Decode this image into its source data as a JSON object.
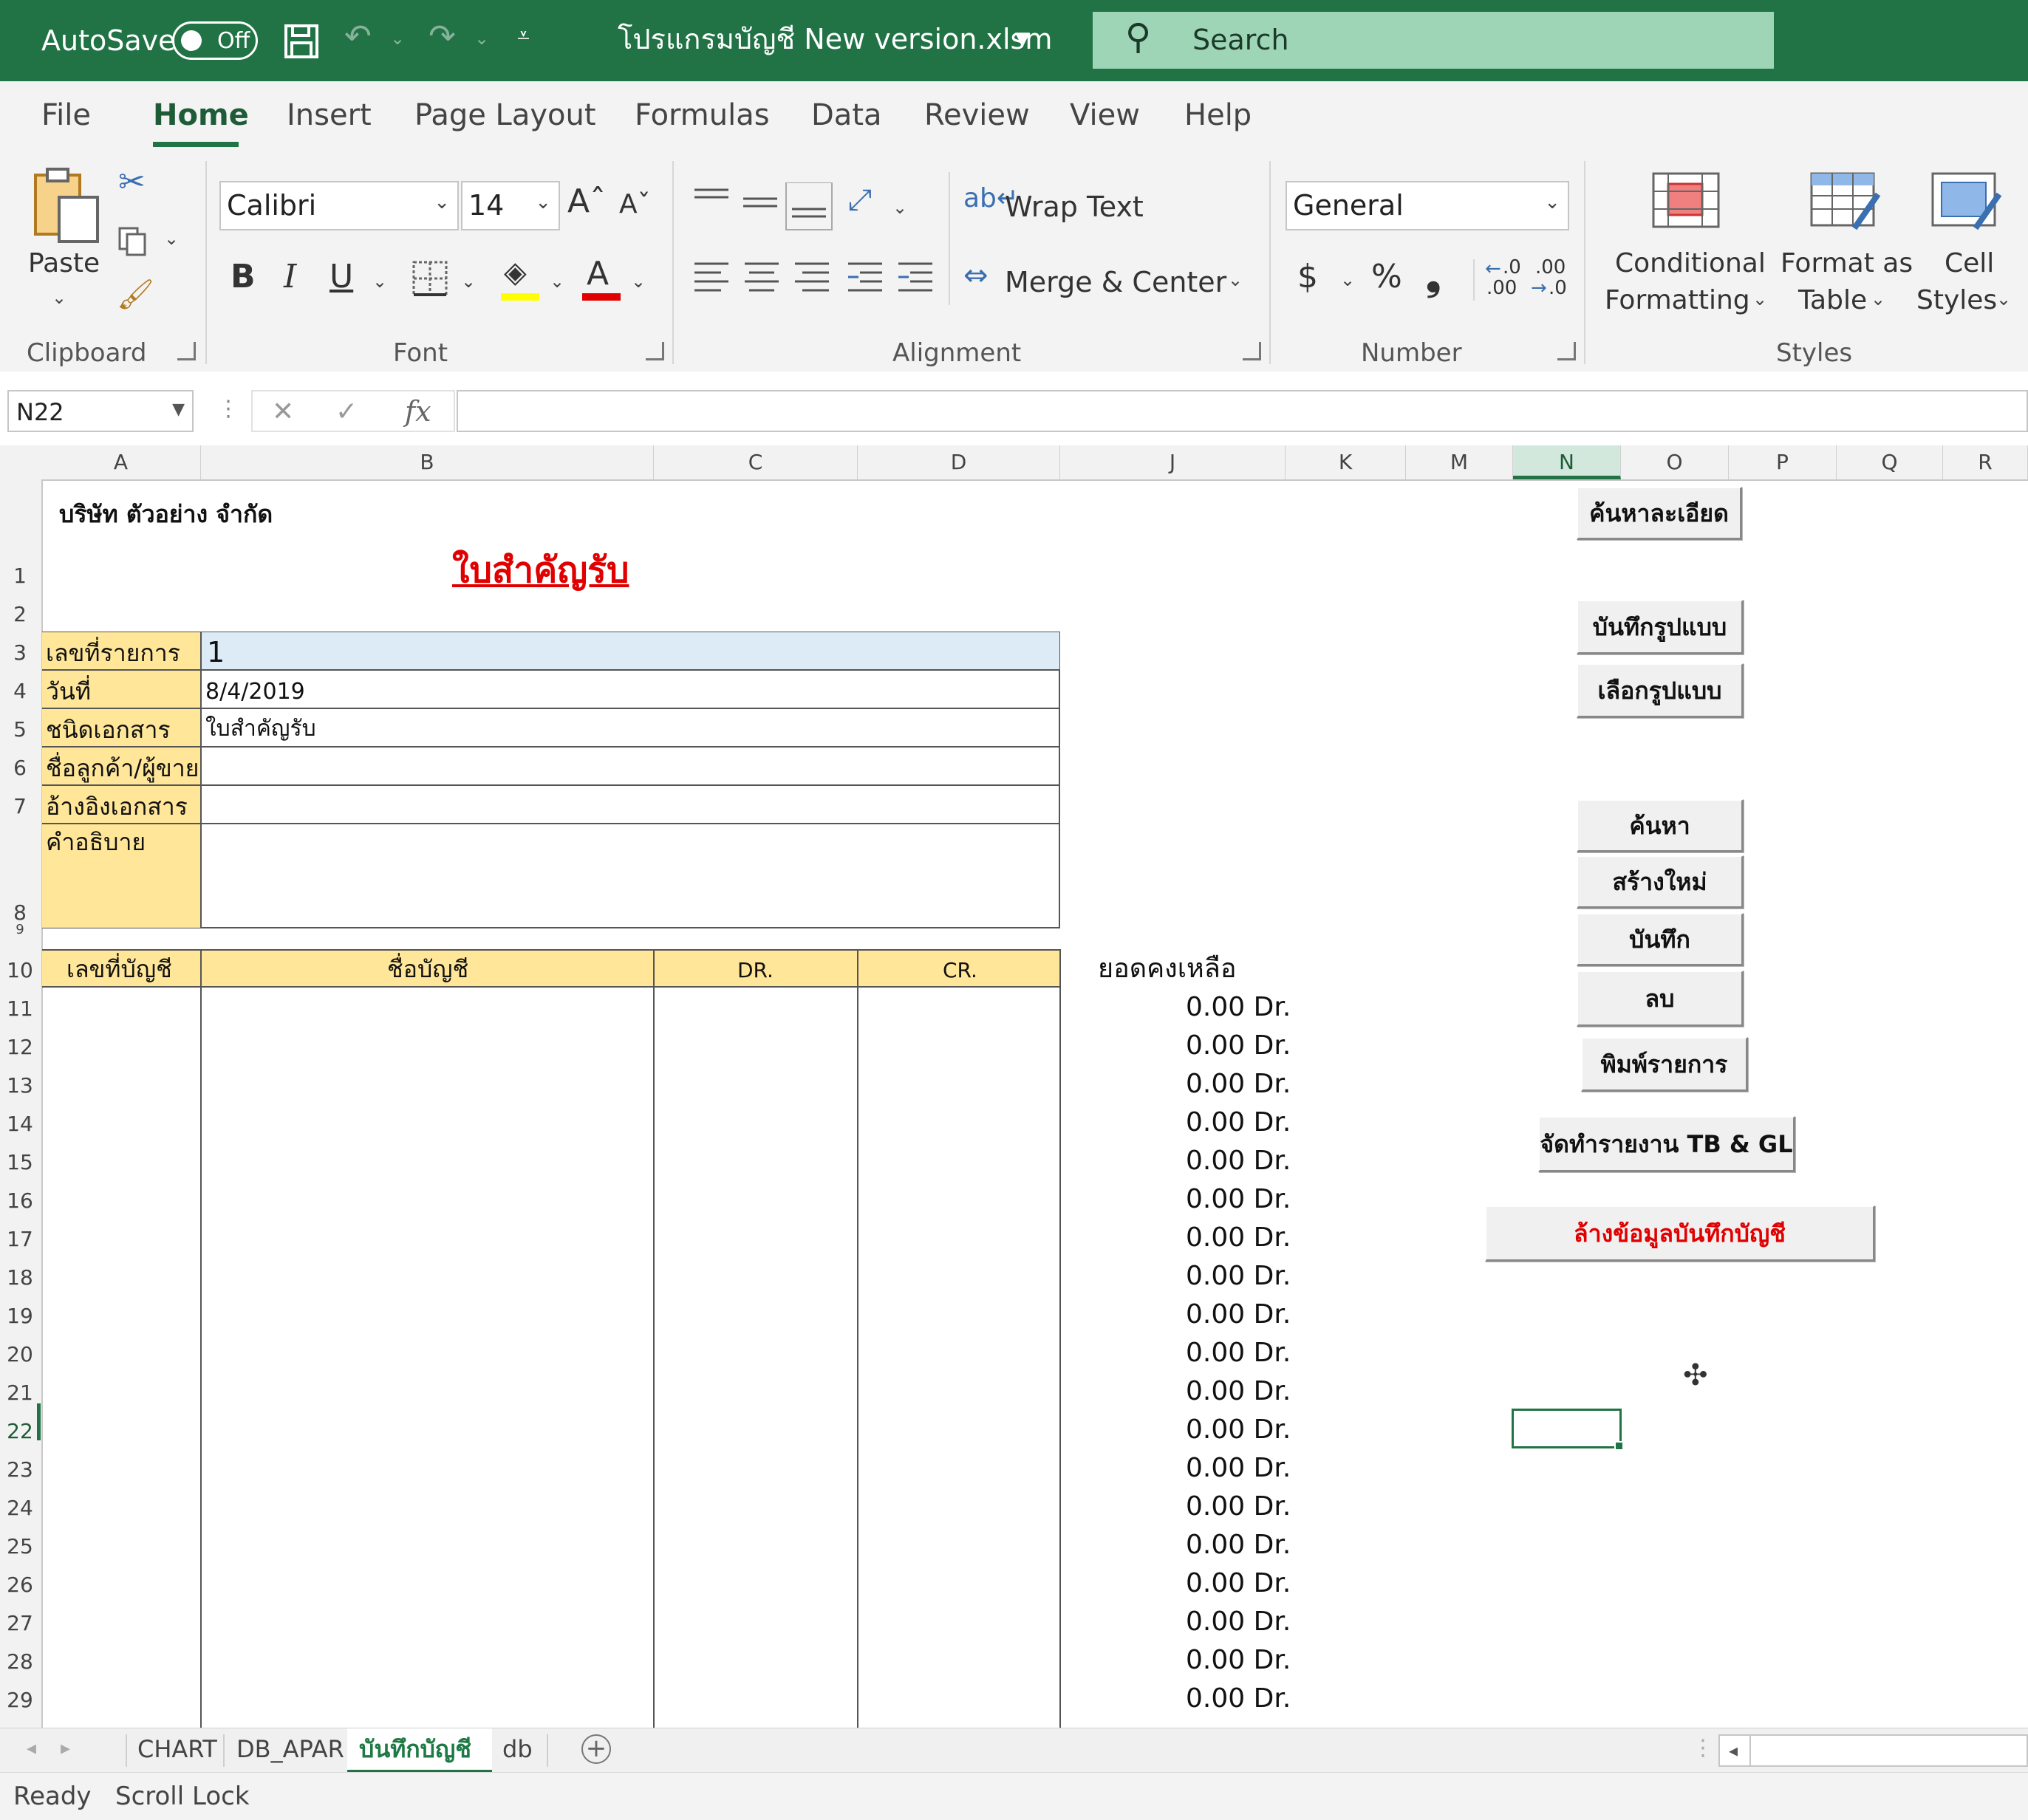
{
  "titlebar": {
    "autosave_label": "AutoSave",
    "autosave_state": "Off",
    "filename": "โปรแกรมบัญชี New version.xlsm",
    "search_placeholder": "Search"
  },
  "ribbon_tabs": [
    "File",
    "Home",
    "Insert",
    "Page Layout",
    "Formulas",
    "Data",
    "Review",
    "View",
    "Help"
  ],
  "active_tab": "Home",
  "ribbon": {
    "clipboard": {
      "label": "Clipboard",
      "paste": "Paste"
    },
    "font": {
      "label": "Font",
      "name": "Calibri",
      "size": "14",
      "bold": "B",
      "italic": "I",
      "underline": "U",
      "fill_color": "#ffff00",
      "font_color": "#e00000"
    },
    "alignment": {
      "label": "Alignment",
      "wrap_text": "Wrap Text",
      "merge_center": "Merge & Center"
    },
    "number": {
      "label": "Number",
      "format": "General",
      "currency": "$",
      "percent": "%",
      "comma": "❟",
      "inc_decimal": ".0",
      "inc_decimal_b": ".00",
      "dec_decimal": ".00",
      "dec_decimal_b": ".0"
    },
    "styles": {
      "label": "Styles",
      "conditional_1": "Conditional",
      "conditional_2": "Formatting",
      "format_table_1": "Format as",
      "format_table_2": "Table",
      "cell_styles_1": "Cell",
      "cell_styles_2": "Styles"
    }
  },
  "formula_bar": {
    "name_box": "N22",
    "fx": "fx",
    "value": ""
  },
  "columns": [
    {
      "key": "A",
      "selected": false
    },
    {
      "key": "B",
      "selected": false
    },
    {
      "key": "C",
      "selected": false
    },
    {
      "key": "D",
      "selected": false
    },
    {
      "key": "J",
      "selected": false
    },
    {
      "key": "K",
      "selected": false
    },
    {
      "key": "M",
      "selected": false
    },
    {
      "key": "N",
      "selected": true
    },
    {
      "key": "O",
      "selected": false
    },
    {
      "key": "P",
      "selected": false
    },
    {
      "key": "Q",
      "selected": false
    },
    {
      "key": "R",
      "selected": false
    }
  ],
  "rows": [
    "1",
    "2",
    "3",
    "4",
    "5",
    "6",
    "7",
    "8",
    "9",
    "10",
    "11",
    "12",
    "13",
    "14",
    "15",
    "16",
    "17",
    "18",
    "19",
    "20",
    "21",
    "22",
    "23",
    "24",
    "25",
    "26",
    "27",
    "28",
    "29"
  ],
  "selected_row": "22",
  "sheet": {
    "company": "บริษัท ตัวอย่าง จำกัด",
    "title": "ใบสำคัญรับ",
    "form": [
      {
        "label": "เลขที่รายการ",
        "value": "1"
      },
      {
        "label": "วันที่",
        "value": "8/4/2019"
      },
      {
        "label": "ชนิดเอกสาร",
        "value": "ใบสำคัญรับ"
      },
      {
        "label": "ชื่อลูกค้า/ผู้ขาย",
        "value": ""
      },
      {
        "label": "อ้างอิงเอกสาร",
        "value": ""
      },
      {
        "label": "คำอธิบาย",
        "value": ""
      }
    ],
    "table_headers": {
      "account_no": "เลขที่บัญชี",
      "account_name": "ชื่อบัญชี",
      "dr": "DR.",
      "cr": "CR."
    },
    "balance_header": "ยอดคงเหลือ",
    "balances": [
      "0.00 Dr.",
      "0.00 Dr.",
      "0.00 Dr.",
      "0.00 Dr.",
      "0.00 Dr.",
      "0.00 Dr.",
      "0.00 Dr.",
      "0.00 Dr.",
      "0.00 Dr.",
      "0.00 Dr.",
      "0.00 Dr.",
      "0.00 Dr.",
      "0.00 Dr.",
      "0.00 Dr.",
      "0.00 Dr.",
      "0.00 Dr.",
      "0.00 Dr.",
      "0.00 Dr.",
      "0.00 Dr."
    ],
    "buttons": {
      "search_detail": "ค้นหาละเอียด",
      "save_template": "บันทึกรูปแบบ",
      "select_template": "เลือกรูปแบบ",
      "search": "ค้นหา",
      "create_new": "สร้างใหม่",
      "save": "บันทึก",
      "delete": "ลบ",
      "print": "พิมพ์รายการ",
      "report": "จัดทำรายงาน TB & GL",
      "clear": "ล้างข้อมูลบันทึกบัญชี"
    }
  },
  "sheet_tabs": [
    "CHART",
    "DB_APAR",
    "บันทึกบัญชี",
    "db"
  ],
  "active_sheet": "บันทึกบัญชี",
  "status": {
    "ready": "Ready",
    "scroll_lock": "Scroll Lock"
  },
  "colors": {
    "excel_green": "#217346",
    "label_fill": "#ffe699",
    "selected_cell_fill": "#ddebf7",
    "title_red": "#e00000"
  }
}
